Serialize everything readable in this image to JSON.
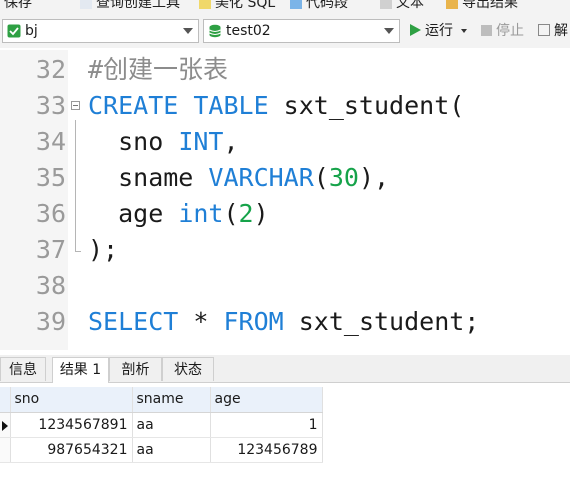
{
  "toolbar": {
    "items": [
      "保存",
      "查询创建工具",
      "美化 SQL",
      "代码段",
      "文本",
      "导出结果"
    ]
  },
  "connection": {
    "value": "bj"
  },
  "database": {
    "value": "test02"
  },
  "run_label": "运行",
  "stop_label": "停止",
  "explain_label": "解",
  "editor": {
    "lines": [
      {
        "num": "32",
        "tokens": [
          {
            "t": "#创建一张表",
            "c": "cmt"
          }
        ]
      },
      {
        "num": "33",
        "tokens": [
          {
            "t": "CREATE TABLE",
            "c": "kw"
          },
          {
            "t": " sxt_student(",
            "c": ""
          }
        ]
      },
      {
        "num": "34",
        "tokens": [
          {
            "t": "  sno ",
            "c": ""
          },
          {
            "t": "INT",
            "c": "kw"
          },
          {
            "t": ",",
            "c": ""
          }
        ]
      },
      {
        "num": "35",
        "tokens": [
          {
            "t": "  sname ",
            "c": ""
          },
          {
            "t": "VARCHAR",
            "c": "kw"
          },
          {
            "t": "(",
            "c": ""
          },
          {
            "t": "30",
            "c": "num"
          },
          {
            "t": "),",
            "c": ""
          }
        ]
      },
      {
        "num": "36",
        "tokens": [
          {
            "t": "  age ",
            "c": ""
          },
          {
            "t": "int",
            "c": "kw"
          },
          {
            "t": "(",
            "c": ""
          },
          {
            "t": "2",
            "c": "num"
          },
          {
            "t": ")",
            "c": ""
          }
        ]
      },
      {
        "num": "37",
        "tokens": [
          {
            "t": ");",
            "c": ""
          }
        ]
      },
      {
        "num": "38",
        "tokens": []
      },
      {
        "num": "39",
        "tokens": [
          {
            "t": "SELECT",
            "c": "kw"
          },
          {
            "t": " * ",
            "c": ""
          },
          {
            "t": "FROM",
            "c": "kw"
          },
          {
            "t": " sxt_student;",
            "c": ""
          }
        ]
      }
    ]
  },
  "result_tabs": [
    "信息",
    "结果 1",
    "剖析",
    "状态"
  ],
  "result": {
    "columns": [
      "sno",
      "sname",
      "age"
    ],
    "rows": [
      [
        "1234567891",
        "aa",
        "1"
      ],
      [
        "987654321",
        "aa",
        "123456789"
      ]
    ]
  },
  "colors": {
    "keyword": "#1f7fd6",
    "number": "#16a34a",
    "comment": "#8c8c8c",
    "run": "#2ea043"
  }
}
